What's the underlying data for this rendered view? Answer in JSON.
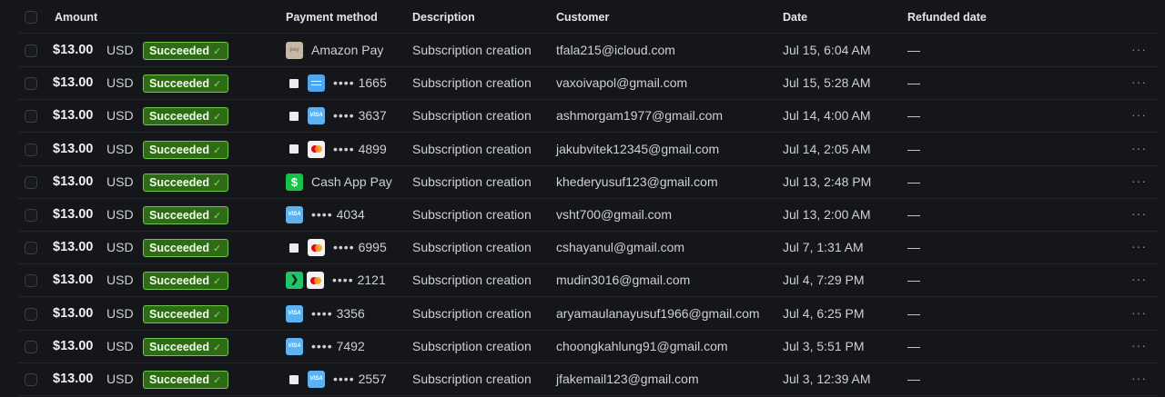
{
  "header": {
    "amount": "Amount",
    "payment_method": "Payment method",
    "description": "Description",
    "customer": "Customer",
    "date": "Date",
    "refunded_date": "Refunded date"
  },
  "colors": {
    "background": "#151619",
    "succeeded_badge_bg": "#2f6a17",
    "succeeded_badge_border": "#6fc84a"
  },
  "rows": [
    {
      "amount": "$13.00",
      "currency": "USD",
      "status": "Succeeded",
      "pm_type": "amazon-pay",
      "pm_text": "Amazon Pay",
      "pm_last4": "",
      "description": "Subscription creation",
      "customer": "tfala215@icloud.com",
      "date": "Jul 15, 6:04 AM",
      "refunded": "—",
      "more": "···"
    },
    {
      "amount": "$13.00",
      "currency": "USD",
      "status": "Succeeded",
      "pm_type": "card-generic",
      "pm_text": "",
      "pm_last4": "1665",
      "description": "Subscription creation",
      "customer": "vaxoivapol@gmail.com",
      "date": "Jul 15, 5:28 AM",
      "refunded": "—",
      "more": "···"
    },
    {
      "amount": "$13.00",
      "currency": "USD",
      "status": "Succeeded",
      "pm_type": "visa",
      "pm_text": "",
      "pm_last4": "3637",
      "description": "Subscription creation",
      "customer": "ashmorgam1977@gmail.com",
      "date": "Jul 14, 4:00 AM",
      "refunded": "—",
      "more": "···"
    },
    {
      "amount": "$13.00",
      "currency": "USD",
      "status": "Succeeded",
      "pm_type": "mastercard",
      "pm_text": "",
      "pm_last4": "4899",
      "description": "Subscription creation",
      "customer": "jakubvitek12345@gmail.com",
      "date": "Jul 14, 2:05 AM",
      "refunded": "—",
      "more": "···"
    },
    {
      "amount": "$13.00",
      "currency": "USD",
      "status": "Succeeded",
      "pm_type": "cash-app",
      "pm_text": "Cash App Pay",
      "pm_last4": "",
      "description": "Subscription creation",
      "customer": "khederyusuf123@gmail.com",
      "date": "Jul 13, 2:48 PM",
      "refunded": "—",
      "more": "···"
    },
    {
      "amount": "$13.00",
      "currency": "USD",
      "status": "Succeeded",
      "pm_type": "visa-only",
      "pm_text": "",
      "pm_last4": "4034",
      "description": "Subscription creation",
      "customer": "vsht700@gmail.com",
      "date": "Jul 13, 2:00 AM",
      "refunded": "—",
      "more": "···"
    },
    {
      "amount": "$13.00",
      "currency": "USD",
      "status": "Succeeded",
      "pm_type": "mastercard",
      "pm_text": "",
      "pm_last4": "6995",
      "description": "Subscription creation",
      "customer": "cshayanul@gmail.com",
      "date": "Jul 7, 1:31 AM",
      "refunded": "—",
      "more": "···"
    },
    {
      "amount": "$13.00",
      "currency": "USD",
      "status": "Succeeded",
      "pm_type": "link-mastercard",
      "pm_text": "",
      "pm_last4": "2121",
      "description": "Subscription creation",
      "customer": "mudin3016@gmail.com",
      "date": "Jul 4, 7:29 PM",
      "refunded": "—",
      "more": "···"
    },
    {
      "amount": "$13.00",
      "currency": "USD",
      "status": "Succeeded",
      "pm_type": "visa-only",
      "pm_text": "",
      "pm_last4": "3356",
      "description": "Subscription creation",
      "customer": "aryamaulanayusuf1966@gmail.com",
      "date": "Jul 4, 6:25 PM",
      "refunded": "—",
      "more": "···"
    },
    {
      "amount": "$13.00",
      "currency": "USD",
      "status": "Succeeded",
      "pm_type": "visa-only",
      "pm_text": "",
      "pm_last4": "7492",
      "description": "Subscription creation",
      "customer": "choongkahlung91@gmail.com",
      "date": "Jul 3, 5:51 PM",
      "refunded": "—",
      "more": "···"
    },
    {
      "amount": "$13.00",
      "currency": "USD",
      "status": "Succeeded",
      "pm_type": "visa",
      "pm_text": "",
      "pm_last4": "2557",
      "description": "Subscription creation",
      "customer": "jfakemail123@gmail.com",
      "date": "Jul 3, 12:39 AM",
      "refunded": "—",
      "more": "···"
    }
  ]
}
